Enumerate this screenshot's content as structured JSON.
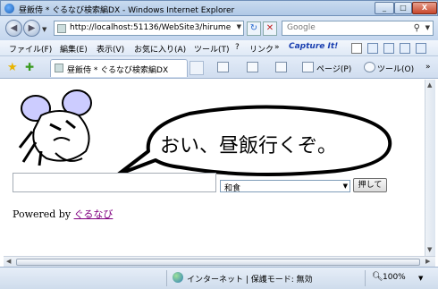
{
  "window": {
    "title": "昼飯侍 * ぐるなび検索編DX - Windows Internet Explorer"
  },
  "address_bar": {
    "url": "http://localhost:51136/WebSite3/hirumeshi3"
  },
  "search_box": {
    "placeholder": "Google"
  },
  "menu": {
    "file": "ファイル(F)",
    "edit": "編集(E)",
    "view": "表示(V)",
    "favorites": "お気に入り(A)",
    "tools": "ツール(T)",
    "help": "?",
    "links": "リンク",
    "links_more": "»",
    "capture": "Capture It!"
  },
  "tab": {
    "label": "昼飯侍 * ぐるなび検索編DX"
  },
  "command_bar": {
    "page": "ページ(P)",
    "tools": "ツール(O)",
    "more": "»"
  },
  "page": {
    "speech": "おい、昼飯行くぞ。",
    "keyword_value": "",
    "genre_selected": "和食",
    "submit_label": "押して",
    "powered_prefix": "Powered by ",
    "powered_link": "ぐるなび"
  },
  "status_bar": {
    "zone": "インターネット | 保護モード: 無効",
    "zoom": "100%"
  },
  "colors": {
    "link_visited": "#800080",
    "chrome_blue": "#c4d6ee"
  }
}
